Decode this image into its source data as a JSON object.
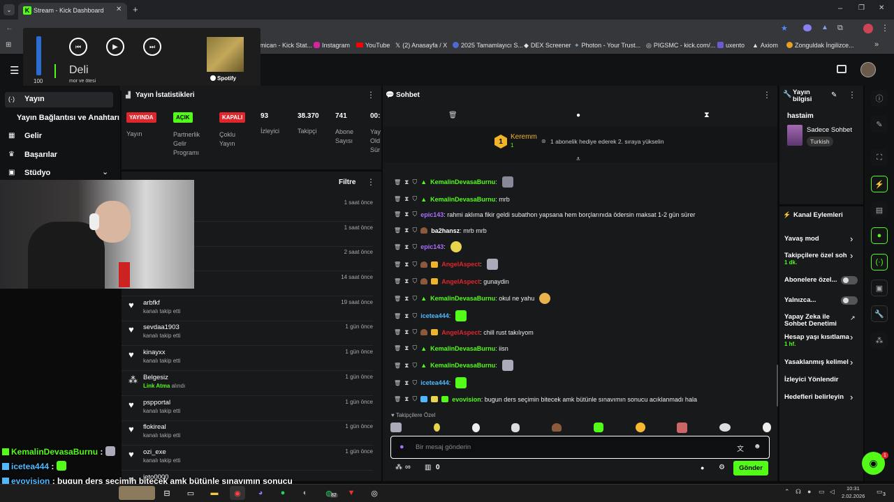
{
  "browser": {
    "tab_title": "Stream - Kick Dashboard"
  },
  "bookmarks": [
    "mican - Kick Stat...",
    "Instagram",
    "YouTube",
    "(2) Anasayfa / X",
    "2025 Tamamlayıcı S...",
    "DEX Screener",
    "Photon - Your Trust...",
    "PIGSMC - kick.com/...",
    "uxento",
    "Axiom",
    "Zonguldak İngilizce..."
  ],
  "spotify": {
    "volume": "100",
    "track": "Deli",
    "artist": "mor ve ötesi",
    "brand": "Spotify"
  },
  "sidebar": {
    "items": [
      "Yayın",
      "Yayın Bağlantısı ve Anahtarı",
      "Gelir",
      "Başarılar",
      "Stüdyo"
    ]
  },
  "stats": {
    "title": "Yayın İstatistikleri",
    "badges": [
      {
        "text": "YAYINDA",
        "label": "Yayın",
        "color": "#e0262d"
      },
      {
        "text": "AÇIK",
        "label": "Partnerlik Gelir Programı",
        "color": "#53fc18"
      },
      {
        "text": "KAPALI",
        "label": "Çoklu Yayın",
        "color": "#e0262d"
      }
    ],
    "numbers": [
      {
        "value": "93",
        "label": "İzleyici"
      },
      {
        "value": "38.370",
        "label": "Takipçi"
      },
      {
        "value": "741",
        "label": "Abone Sayısı"
      },
      {
        "value": "00:",
        "label": "Yay Old Sür"
      }
    ]
  },
  "events": {
    "filter": "Filtre",
    "rows": [
      {
        "name": "",
        "sub": "",
        "time": "1 saat önce"
      },
      {
        "name": "",
        "sub": "",
        "time": "1 saat önce"
      },
      {
        "name": "",
        "sub": "",
        "time": "2 saat önce"
      },
      {
        "name": "",
        "sub": "",
        "time": "14 saat önce"
      },
      {
        "name": "arbfkf",
        "sub": "kanalı takip etti",
        "time": "19 saat önce"
      },
      {
        "name": "sevdaa1903",
        "sub": "kanalı takip etti",
        "time": "1 gün önce"
      },
      {
        "name": "kinayxx",
        "sub": "kanalı takip etti",
        "time": "1 gün önce"
      },
      {
        "name": "Belgesiz",
        "sub_link": "Link Atma",
        "sub": "alındı",
        "time": "1 gün önce"
      },
      {
        "name": "pspportal",
        "sub": "kanalı takip etti",
        "time": "1 gün önce"
      },
      {
        "name": "flokireal",
        "sub": "kanalı takip etti",
        "time": "1 gün önce"
      },
      {
        "name": "ozi_exe",
        "sub": "kanalı takip etti",
        "time": "1 gün önce"
      },
      {
        "name": "jeto0000",
        "sub": "",
        "time": ""
      }
    ]
  },
  "chat": {
    "title": "Sohbet",
    "pinned_user": "Keremm",
    "pinned_rank": "1",
    "pinned_count": "1",
    "pinned_text": "1 abonelik hediye ederek 2. sıraya yükselin",
    "followers_only": "Takipçilere Özel",
    "input_placeholder": "Bir mesaj gönderin",
    "send": "Gönder",
    "count_infinity": "∞",
    "count_zero": "0",
    "messages": [
      {
        "user": "KemalinDevasaBurnu",
        "color": "#53fc18",
        "text": "",
        "emote": "#889"
      },
      {
        "user": "KemalinDevasaBurnu",
        "color": "#53fc18",
        "text": " mrb",
        "emote": ""
      },
      {
        "user": "epic143",
        "color": "#a970ff",
        "text": " rahmi aklıma fikir geldi subathon yapsana hem borçlarınıda ödersin maksat 1-2 gün sürer",
        "emote": ""
      },
      {
        "user": "ba2hansz",
        "color": "#fff",
        "text": " mrb mrb",
        "emote": ""
      },
      {
        "user": "epic143",
        "color": "#a970ff",
        "text": "",
        "emote": "#e8d44d"
      },
      {
        "user": "AngelAspect",
        "color": "#e0262d",
        "text": "",
        "emote": "#aab"
      },
      {
        "user": "AngelAspect",
        "color": "#e0262d",
        "text": " gunaydin",
        "emote": ""
      },
      {
        "user": "KemalinDevasaBurnu",
        "color": "#53fc18",
        "text": " okul ne yahu",
        "emote": "#e8b24d"
      },
      {
        "user": "icetea444",
        "color": "#4fb8ff",
        "text": "",
        "emote": "#53fc18"
      },
      {
        "user": "AngelAspect",
        "color": "#e0262d",
        "text": " chill rust takılıyom",
        "emote": ""
      },
      {
        "user": "KemalinDevasaBurnu",
        "color": "#53fc18",
        "text": " iisn",
        "emote": ""
      },
      {
        "user": "KemalinDevasaBurnu",
        "color": "#53fc18",
        "text": "",
        "emote": "#aab"
      },
      {
        "user": "icetea444",
        "color": "#4fb8ff",
        "text": "",
        "emote": "#53fc18"
      },
      {
        "user": "evovision",
        "color": "#53fc18",
        "text": " bugun ders seçimin bitecek amk bütünle sınavımın sonucu acıklanmadı hala",
        "emote": ""
      }
    ]
  },
  "stream_info": {
    "title": "Yayın bilgisi",
    "stream_title": "hastaim",
    "category": "Sadece Sohbet",
    "language": "Turkish"
  },
  "channel_actions": {
    "title": "Kanal Eylemleri",
    "items": [
      {
        "label": "Yavaş mod",
        "sub": "",
        "type": "chevron"
      },
      {
        "label": "Takipçilere özel soh",
        "sub": "1 dk.",
        "type": "chevron"
      },
      {
        "label": "Abonelere özel...",
        "sub": "",
        "type": "toggle"
      },
      {
        "label": "Yalnızca...",
        "sub": "",
        "type": "toggle"
      },
      {
        "label": "Yapay Zeka ile Sohbet Denetimi",
        "sub": "",
        "type": "external"
      },
      {
        "label": "Hesap yaşı kısıtlama",
        "sub": "1 hf.",
        "type": "chevron"
      },
      {
        "label": "Yasaklanmış kelimel",
        "sub": "",
        "type": "chevron"
      },
      {
        "label": "İzleyici Yönlendir",
        "sub": "",
        "type": "none"
      },
      {
        "label": "Hedefleri belirleyin",
        "sub": "",
        "type": "chevron"
      }
    ]
  },
  "overlay_chat": [
    {
      "user": "KemalinDevasaBurnu",
      "text": " :"
    },
    {
      "user": "icetea444",
      "text": " :"
    },
    {
      "user": "evovision",
      "text": " : bugun ders seçimin bitecek amk bütünle sınavımın sonucu"
    },
    {
      "user": "",
      "text": "acıklanmadı hala"
    }
  ],
  "taskbar": {
    "time": "10:31",
    "date": "2.02.2026",
    "badge": "82",
    "notif": "3"
  }
}
